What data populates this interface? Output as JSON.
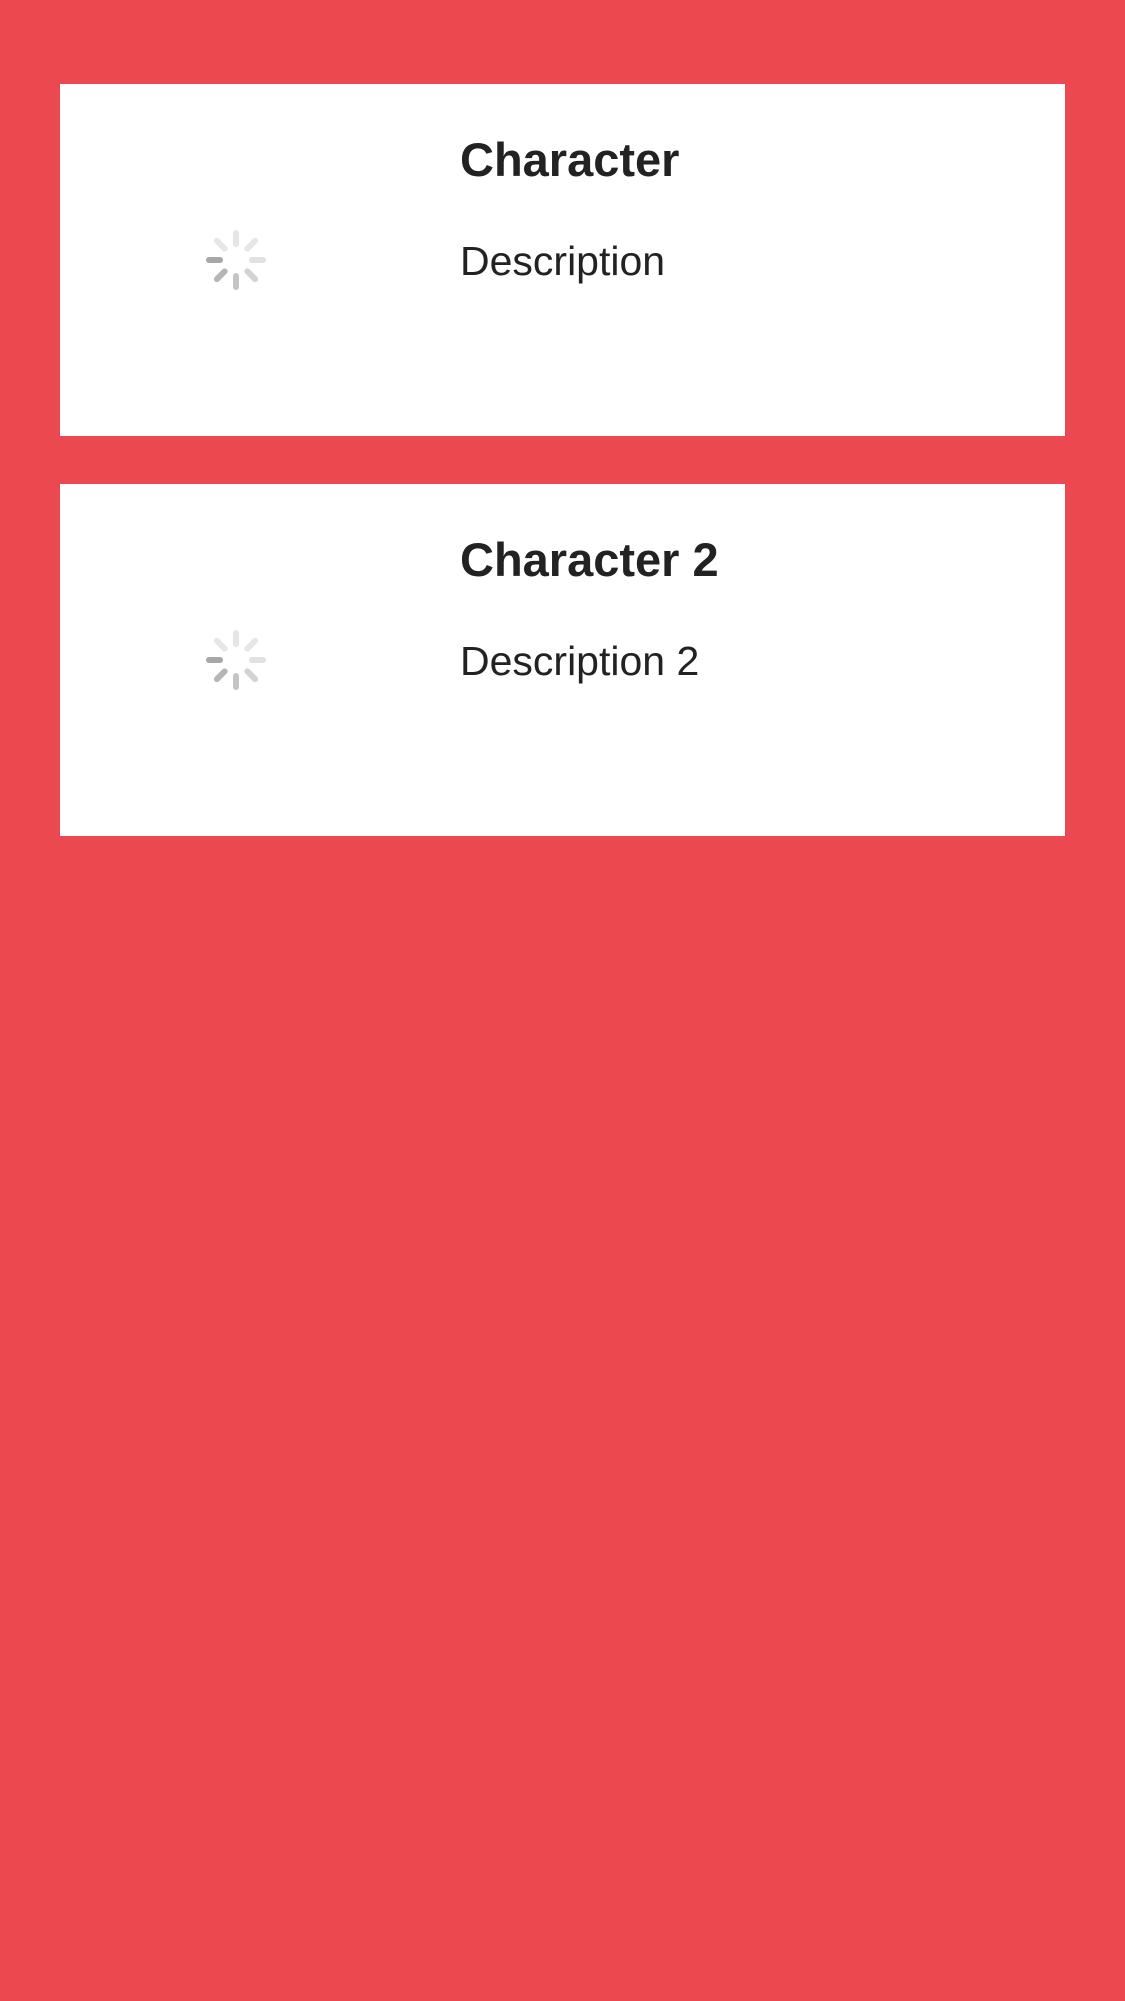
{
  "theme": {
    "background": "#EB4850",
    "card": "#FFFFFF",
    "text": "#222222",
    "spinner": "#9E9E9E"
  },
  "characters": [
    {
      "name": "Character",
      "description": "Description",
      "image_state": "loading",
      "image_icon": "spinner-icon"
    },
    {
      "name": "Character 2",
      "description": "Description 2",
      "image_state": "loading",
      "image_icon": "spinner-icon"
    }
  ]
}
